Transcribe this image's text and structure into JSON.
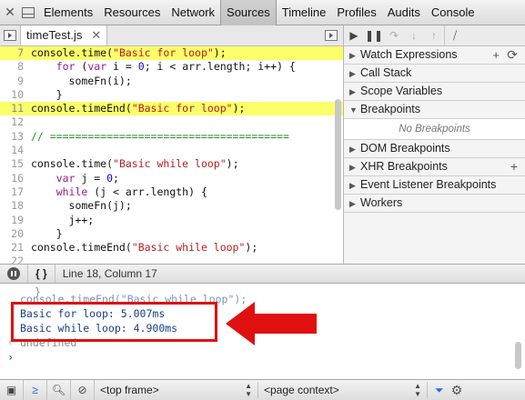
{
  "toolbar": {
    "close_glyph": "✕",
    "tabs": [
      "Elements",
      "Resources",
      "Network",
      "Sources",
      "Timeline",
      "Profiles",
      "Audits",
      "Console"
    ],
    "active_tab": "Sources"
  },
  "editor": {
    "file_tab": "timeTest.js",
    "file_tab_close": "✕",
    "lines": [
      {
        "num": "7",
        "tokens": [
          {
            "t": "console.time(",
            "c": "plain"
          },
          {
            "t": "\"Basic for loop\"",
            "c": "str"
          },
          {
            "t": ");",
            "c": "plain"
          }
        ],
        "hl": true
      },
      {
        "num": "8",
        "tokens": [
          {
            "t": "    ",
            "c": "plain"
          },
          {
            "t": "for",
            "c": "kw"
          },
          {
            "t": " (",
            "c": "plain"
          },
          {
            "t": "var",
            "c": "kw"
          },
          {
            "t": " i = ",
            "c": "plain"
          },
          {
            "t": "0",
            "c": "num"
          },
          {
            "t": "; i < arr.length; i++) {",
            "c": "plain"
          }
        ],
        "hl": false
      },
      {
        "num": "9",
        "tokens": [
          {
            "t": "      someFn(i);",
            "c": "plain"
          }
        ],
        "hl": false
      },
      {
        "num": "10",
        "tokens": [
          {
            "t": "    }",
            "c": "plain"
          }
        ],
        "hl": false
      },
      {
        "num": "11",
        "tokens": [
          {
            "t": "console.timeEnd(",
            "c": "plain"
          },
          {
            "t": "\"Basic for loop\"",
            "c": "str"
          },
          {
            "t": ");",
            "c": "plain"
          }
        ],
        "hl": true
      },
      {
        "num": "12",
        "tokens": [],
        "hl": false
      },
      {
        "num": "13",
        "tokens": [
          {
            "t": "// ======================================",
            "c": "cm"
          }
        ],
        "hl": false
      },
      {
        "num": "14",
        "tokens": [],
        "hl": false
      },
      {
        "num": "15",
        "tokens": [
          {
            "t": "console.time(",
            "c": "plain"
          },
          {
            "t": "\"Basic while loop\"",
            "c": "str"
          },
          {
            "t": ");",
            "c": "plain"
          }
        ],
        "hl": false
      },
      {
        "num": "16",
        "tokens": [
          {
            "t": "    ",
            "c": "plain"
          },
          {
            "t": "var",
            "c": "kw"
          },
          {
            "t": " j = ",
            "c": "plain"
          },
          {
            "t": "0",
            "c": "num"
          },
          {
            "t": ";",
            "c": "plain"
          }
        ],
        "hl": false
      },
      {
        "num": "17",
        "tokens": [
          {
            "t": "    ",
            "c": "plain"
          },
          {
            "t": "while",
            "c": "kw"
          },
          {
            "t": " (j < arr.length) {",
            "c": "plain"
          }
        ],
        "hl": false
      },
      {
        "num": "18",
        "tokens": [
          {
            "t": "      someFn(j);",
            "c": "plain"
          }
        ],
        "hl": false
      },
      {
        "num": "19",
        "tokens": [
          {
            "t": "      j++;",
            "c": "plain"
          }
        ],
        "hl": false
      },
      {
        "num": "20",
        "tokens": [
          {
            "t": "    }",
            "c": "plain"
          }
        ],
        "hl": false
      },
      {
        "num": "21",
        "tokens": [
          {
            "t": "console.timeEnd(",
            "c": "plain"
          },
          {
            "t": "\"Basic while loop\"",
            "c": "str"
          },
          {
            "t": ");",
            "c": "plain"
          }
        ],
        "hl": false
      },
      {
        "num": "22",
        "tokens": [],
        "hl": false
      }
    ]
  },
  "debugger": {
    "sections": [
      {
        "label": "Watch Expressions",
        "expanded": false,
        "actions": [
          "+",
          "⟳"
        ]
      },
      {
        "label": "Call Stack",
        "expanded": false,
        "actions": []
      },
      {
        "label": "Scope Variables",
        "expanded": false,
        "actions": []
      },
      {
        "label": "Breakpoints",
        "expanded": true,
        "actions": []
      },
      {
        "label": "DOM Breakpoints",
        "expanded": false,
        "actions": []
      },
      {
        "label": "XHR Breakpoints",
        "expanded": false,
        "actions": [
          "+"
        ]
      },
      {
        "label": "Event Listener Breakpoints",
        "expanded": false,
        "actions": []
      },
      {
        "label": "Workers",
        "expanded": false,
        "actions": []
      }
    ],
    "no_breakpoints": "No Breakpoints"
  },
  "status": {
    "pretty_print": "{ }",
    "cursor_position": "Line 18, Column 17"
  },
  "console": {
    "faded_brace": "}",
    "faded_line": "console.timeEnd(\"Basic while loop\");",
    "output_1": "Basic for loop: 5.007ms",
    "output_2": "Basic while loop: 4.900ms",
    "undefined": "undefined",
    "prompt": "›",
    "undef_glyph": "‹"
  },
  "bottom": {
    "frame_select": "<top frame>",
    "context_select": "<page context>"
  },
  "colors": {
    "highlight_line": "#fbff6a",
    "annotation_red": "#e01010"
  }
}
